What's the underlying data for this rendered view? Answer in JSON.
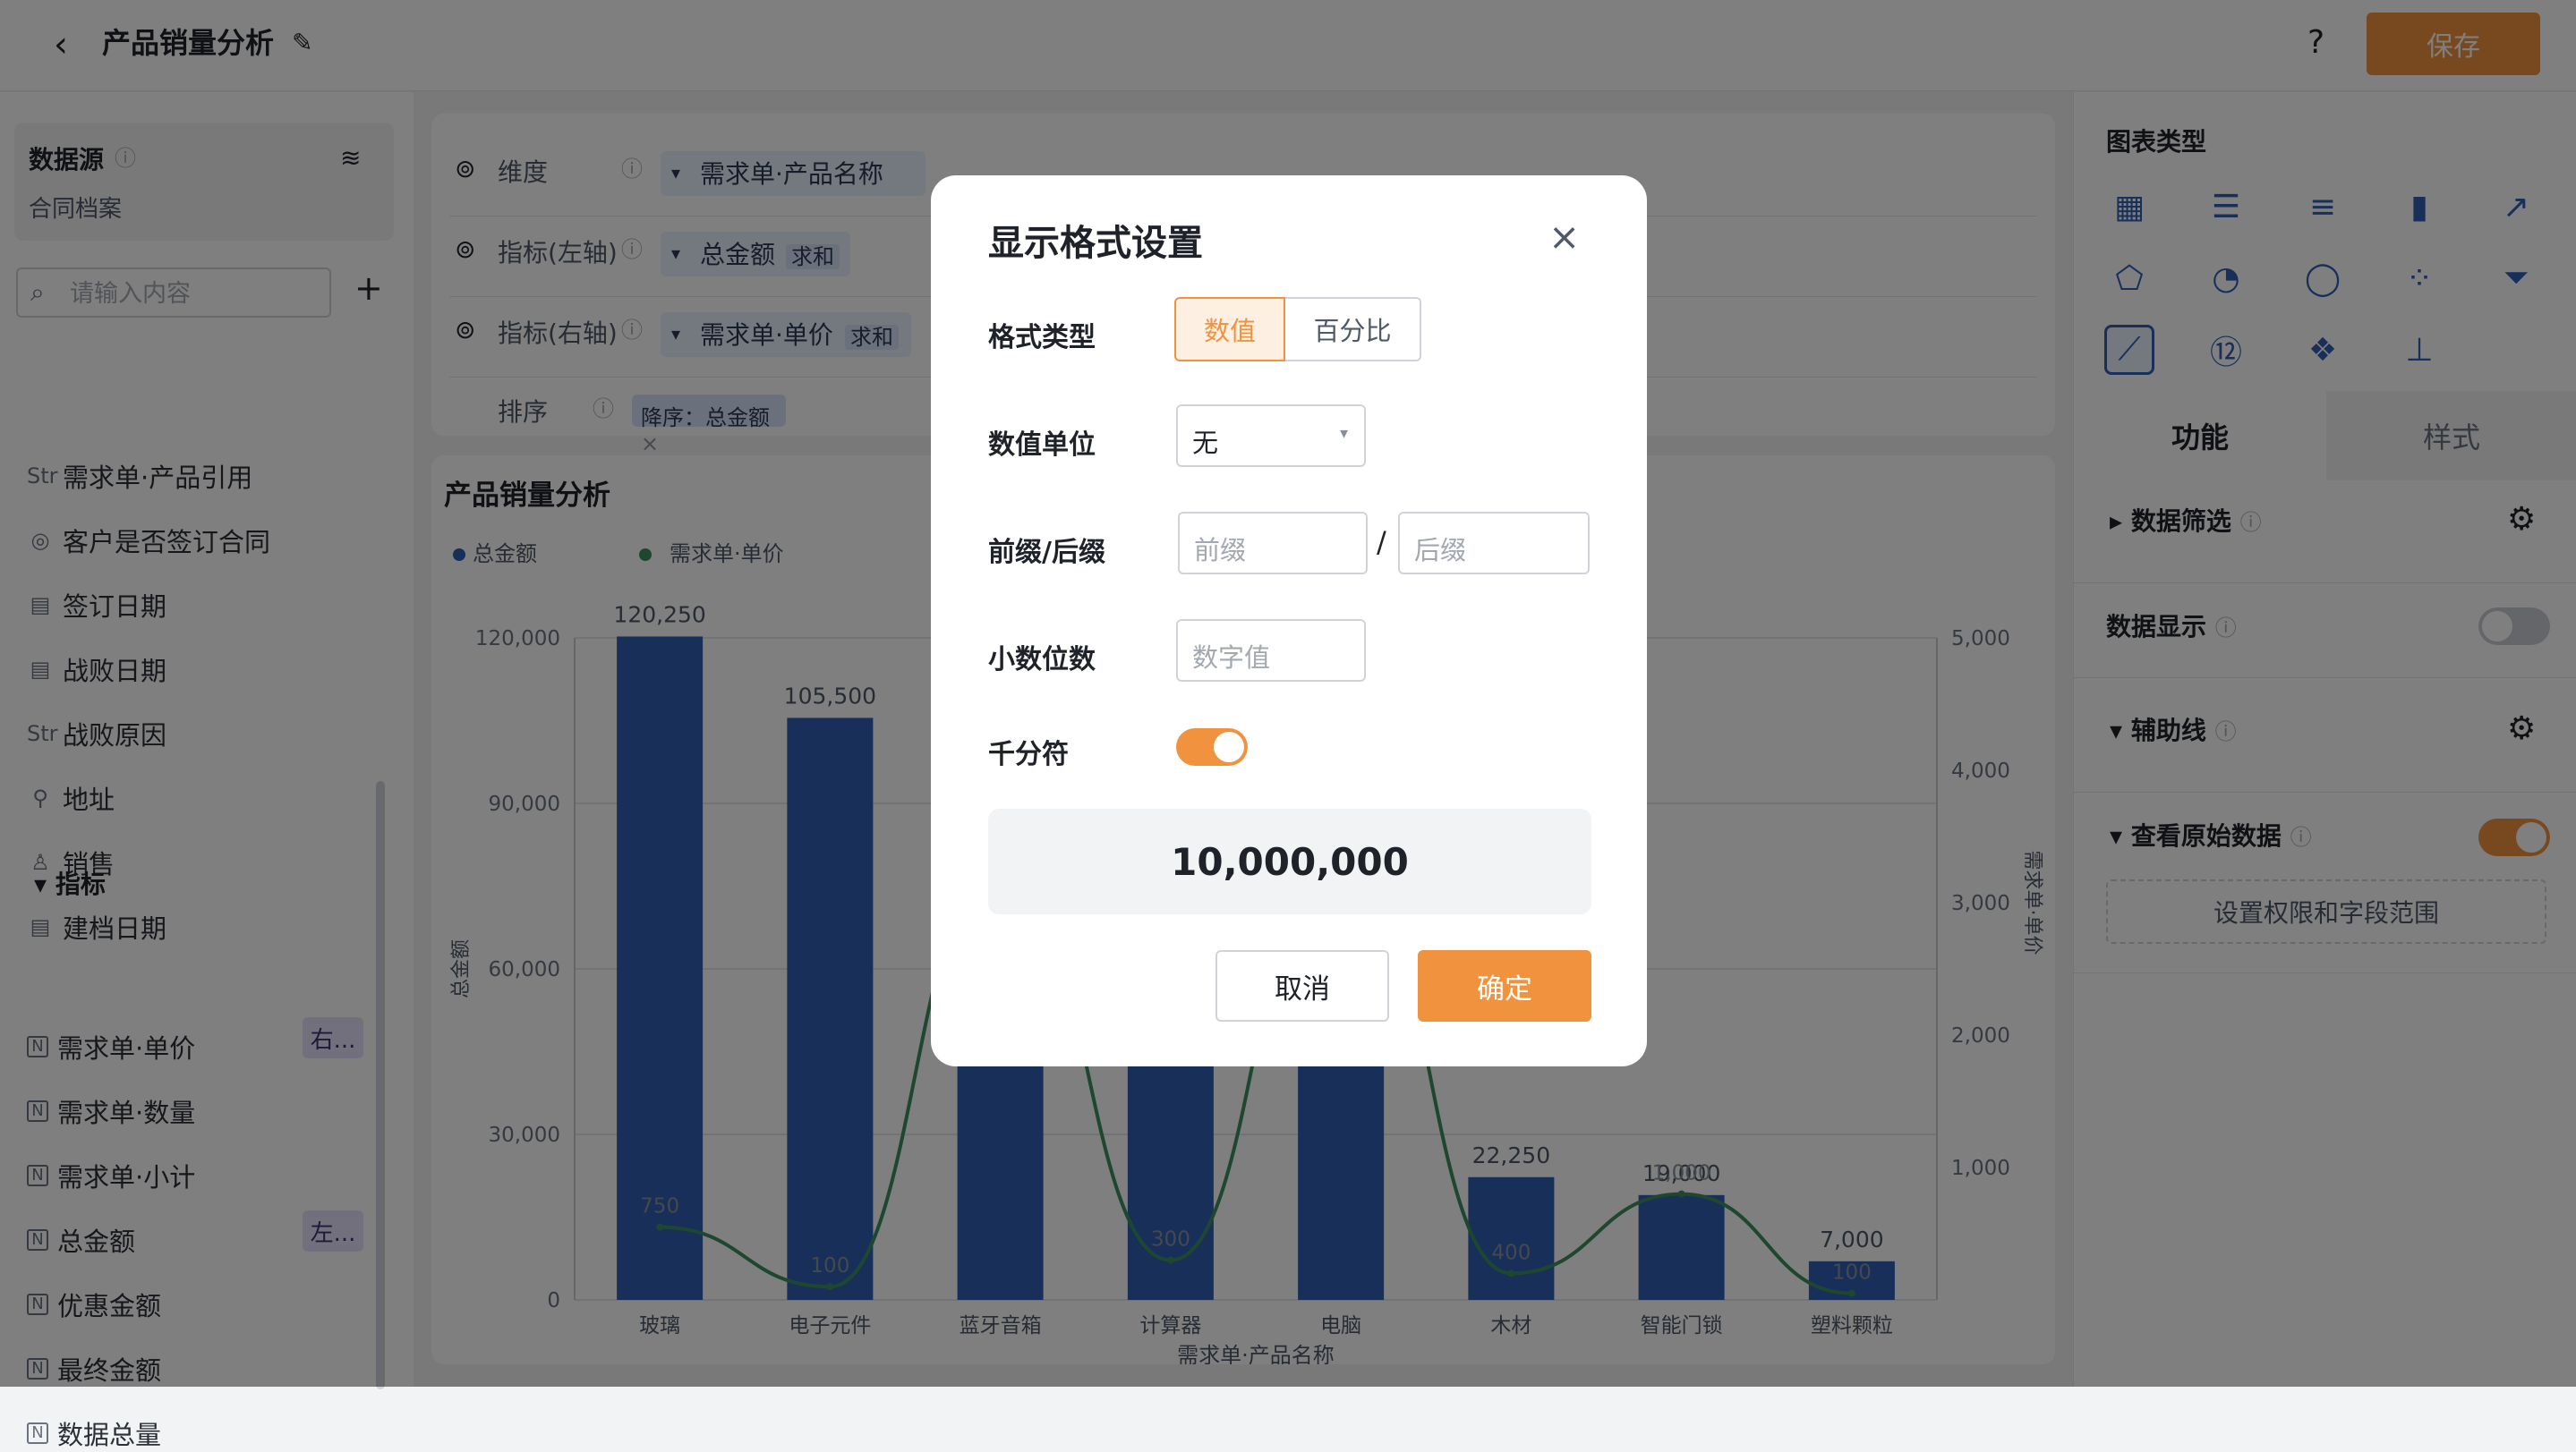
{
  "header": {
    "title": "产品销量分析",
    "save_label": "保存",
    "help": "?"
  },
  "left": {
    "datasource_label": "数据源",
    "datasource_name": "合同档案",
    "search_placeholder": "请输入内容",
    "fields": [
      {
        "icon": "Str",
        "label": "需求单·产品引用"
      },
      {
        "icon": "◎",
        "label": "客户是否签订合同"
      },
      {
        "icon": "▤",
        "label": "签订日期"
      },
      {
        "icon": "▤",
        "label": "战败日期"
      },
      {
        "icon": "Str",
        "label": "战败原因"
      },
      {
        "icon": "⚲",
        "label": "地址"
      },
      {
        "icon": "♙",
        "label": "销售"
      },
      {
        "icon": "▤",
        "label": "建档日期"
      }
    ],
    "metrics_header": "指标",
    "metrics": [
      {
        "label": "需求单·单价",
        "badge": "右..."
      },
      {
        "label": "需求单·数量",
        "badge": ""
      },
      {
        "label": "需求单·小计",
        "badge": ""
      },
      {
        "label": "总金额",
        "badge": "左..."
      },
      {
        "label": "优惠金额",
        "badge": ""
      },
      {
        "label": "最终金额",
        "badge": ""
      },
      {
        "label": "数据总量",
        "badge": ""
      }
    ],
    "metric_icon": "N"
  },
  "config": {
    "dim_label": "维度",
    "dim_value": "需求单·产品名称",
    "left_label": "指标(左轴)",
    "left_value": "总金额",
    "left_agg": "求和",
    "right_label": "指标(右轴)",
    "right_value": "需求单·单价",
    "right_agg": "求和",
    "sort_label": "排序",
    "sort_value": "降序：总金额"
  },
  "chart_data": {
    "type": "bar",
    "title": "产品销量分析",
    "categories": [
      "玻璃",
      "电子元件",
      "蓝牙音箱",
      "计算器",
      "电脑",
      "木材",
      "智能门锁",
      "塑料颗粒"
    ],
    "series": [
      {
        "name": "总金额",
        "type": "bar",
        "axis": "left",
        "values": [
          120250,
          105500,
          60000,
          60000,
          60000,
          22250,
          19000,
          7000
        ],
        "data_labels": [
          "120,250",
          "105,500",
          "",
          "",
          "",
          "22,250",
          "19,000",
          "7,000"
        ]
      },
      {
        "name": "需求单·单价",
        "type": "line",
        "axis": "right",
        "values": [
          550,
          100,
          3300,
          300,
          3500,
          200,
          800,
          50
        ],
        "data_labels": [
          "750",
          "100",
          "",
          "300",
          "",
          "400",
          "1,000",
          "100"
        ]
      }
    ],
    "xlabel": "需求单·产品名称",
    "ylabel": "总金额",
    "y2label": "需求单·单价",
    "ylim": [
      0,
      120000
    ],
    "y2lim": [
      0,
      5000
    ],
    "yticks": [
      "0",
      "30,000",
      "60,000",
      "90,000",
      "120,000"
    ],
    "y2ticks": [
      "1,000",
      "2,000",
      "3,000",
      "4,000",
      "5,000"
    ],
    "colors": {
      "bar": "#2f5fb3",
      "line": "#3d8f5f"
    },
    "legend": "top-left"
  },
  "right": {
    "chart_type_label": "图表类型",
    "tab_function": "功能",
    "tab_style": "样式",
    "filter_label": "数据筛选",
    "display_label": "数据显示",
    "aux_label": "辅助线",
    "raw_label": "查看原始数据",
    "perm_button": "设置权限和字段范围"
  },
  "modal": {
    "title": "显示格式设置",
    "format_label": "格式类型",
    "opt_number": "数值",
    "opt_percent": "百分比",
    "unit_label": "数值单位",
    "unit_value": "无",
    "affix_label": "前缀/后缀",
    "prefix_placeholder": "前缀",
    "suffix_placeholder": "后缀",
    "slash": "/",
    "decimal_label": "小数位数",
    "decimal_placeholder": "数字值",
    "thousands_label": "千分符",
    "thousands_on": true,
    "preview": "10,000,000",
    "cancel": "取消",
    "confirm": "确定"
  },
  "colors": {
    "accent": "#f0923e",
    "primary_blue": "#2f5fb3",
    "line_green": "#3d8f5f"
  }
}
